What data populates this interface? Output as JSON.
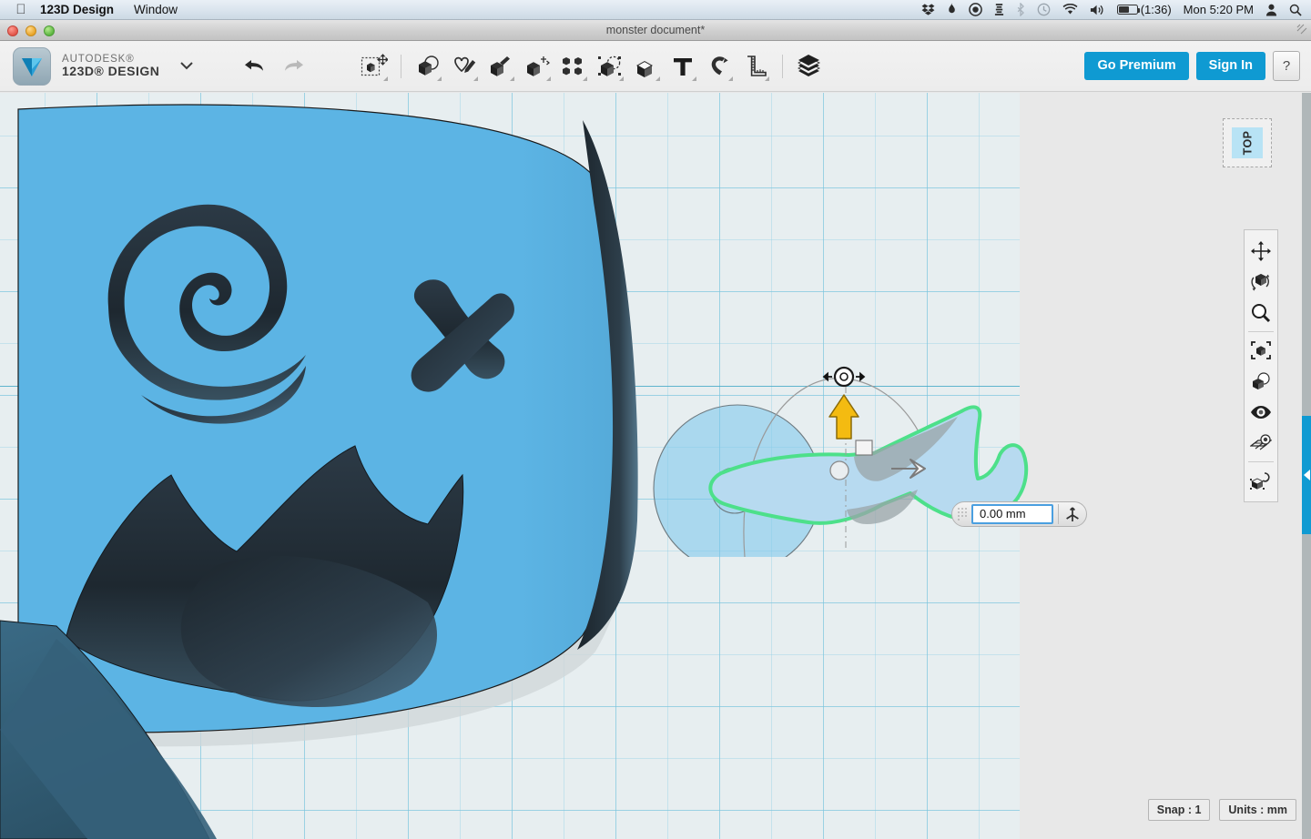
{
  "menubar": {
    "apple_icon": "apple-logo",
    "app_name": "123D Design",
    "menus": [
      "Window"
    ],
    "status_icons": [
      {
        "name": "dropbox-icon",
        "glyph": "❖"
      },
      {
        "name": "flame-icon",
        "glyph": "♨"
      },
      {
        "name": "timer-icon",
        "glyph": "◔"
      },
      {
        "name": "chess-icon",
        "glyph": "♜"
      },
      {
        "name": "bluetooth-icon",
        "glyph": "ᛦ",
        "dim": true
      },
      {
        "name": "time-machine-icon",
        "glyph": "↺"
      },
      {
        "name": "wifi-icon",
        "glyph": "◠"
      },
      {
        "name": "volume-icon",
        "glyph": "▶"
      }
    ],
    "battery_label": "(1:36)",
    "clock": "Mon 5:20 PM",
    "user_icon": "user-account-icon",
    "search_icon": "spotlight-search-icon"
  },
  "window": {
    "title": "monster document*",
    "close_label": "",
    "minimize_label": "",
    "zoom_label": ""
  },
  "brand": {
    "line1": "AUTODESK®",
    "line2": "123D® DESIGN",
    "caret": "⌄"
  },
  "toolbar": {
    "undo_label": "Undo",
    "redo_label": "Redo",
    "items": [
      {
        "name": "transform-tool",
        "label": "Transform",
        "selected": true
      },
      {
        "name": "primitives-tool",
        "label": "Primitives"
      },
      {
        "name": "sketch-tool",
        "label": "Sketch"
      },
      {
        "name": "construct-tool",
        "label": "Construct"
      },
      {
        "name": "modify-tool",
        "label": "Modify"
      },
      {
        "name": "pattern-tool",
        "label": "Pattern"
      },
      {
        "name": "grouping-tool",
        "label": "Grouping"
      },
      {
        "name": "combine-tool",
        "label": "Combine"
      },
      {
        "name": "text-tool",
        "label": "Text"
      },
      {
        "name": "snap-tool",
        "label": "Snap"
      },
      {
        "name": "measure-tool",
        "label": "Measure"
      },
      {
        "name": "material-tool",
        "label": "Material"
      }
    ],
    "go_premium_label": "Go Premium",
    "sign_in_label": "Sign In",
    "help_label": "?"
  },
  "viewcube": {
    "face_label": "TOP"
  },
  "navbar": {
    "items": [
      {
        "name": "pan-tool",
        "label": "Pan"
      },
      {
        "name": "orbit-tool",
        "label": "Orbit"
      },
      {
        "name": "zoom-tool",
        "label": "Zoom"
      },
      {
        "name": "fit-tool",
        "label": "Fit"
      },
      {
        "name": "display-style-tool",
        "label": "Display Style"
      },
      {
        "name": "visibility-tool",
        "label": "Visibility"
      },
      {
        "name": "grid-settings-tool",
        "label": "Grid / Snaps"
      },
      {
        "name": "material-preview-tool",
        "label": "Material"
      }
    ]
  },
  "manipulator": {
    "value": "0.00 mm",
    "placeholder": "0.00 mm",
    "pivot_icon": "axis-pivot-icon",
    "move_arrow_icon": "move-up-arrow-icon",
    "rotate_handle_icon": "rotate-handle-icon",
    "direction_arrow_icon": "direction-right-arrow-icon"
  },
  "statusbar": {
    "snap": "Snap : 1",
    "units": "Units : mm"
  },
  "colors": {
    "accent_blue": "#0f9ad2",
    "monster_body": "#5cb4e4",
    "monster_shadow": "#3a6a85",
    "monster_dark": "#24303a",
    "selection_green": "#4de08a",
    "selected_face": "#b0d9ef",
    "grid_line": "#78c3dc",
    "grid_bg": "#e7eef0",
    "canvas_bg": "#e8e8e8",
    "viewcube_face": "#b8e3f5"
  },
  "panel": {
    "collapse_label": "◀"
  }
}
